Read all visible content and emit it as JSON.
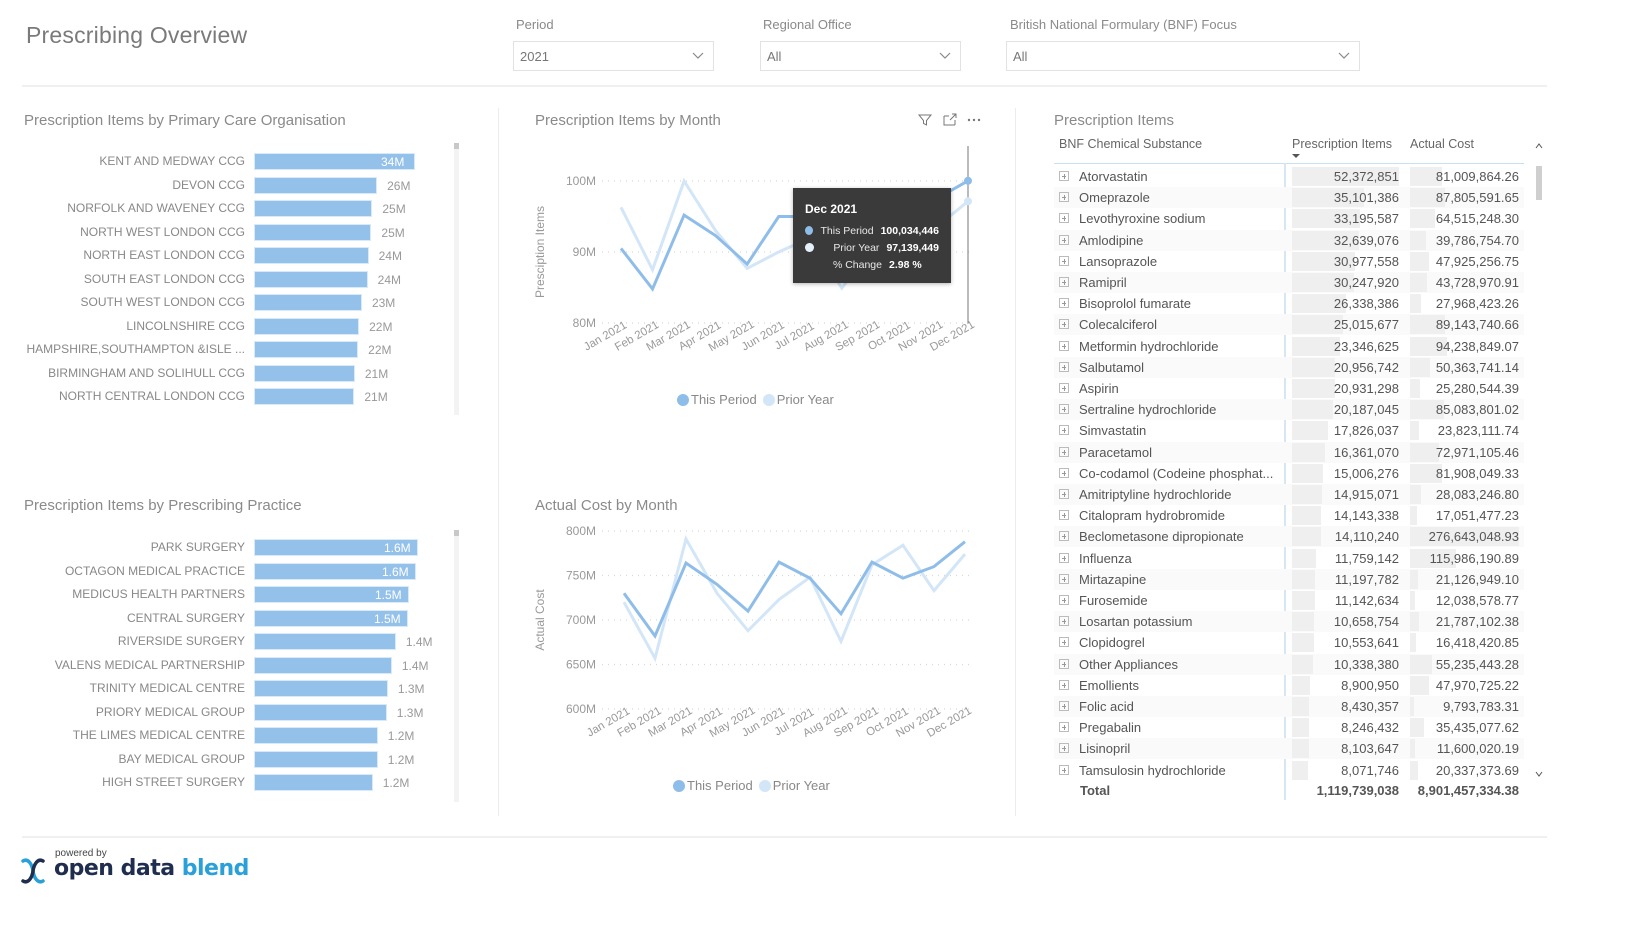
{
  "page": {
    "title": "Prescribing Overview"
  },
  "slicers": [
    {
      "label": "Period",
      "value": "2021"
    },
    {
      "label": "Regional Office",
      "value": "All"
    },
    {
      "label": "British National Formulary (BNF) Focus",
      "value": "All"
    }
  ],
  "colors": {
    "this_period": "#8fbde9",
    "prior_year": "#d3e6f8",
    "bar": "#94c1ea",
    "tooltip_bg": "#3a3a3a"
  },
  "pco_chart": {
    "title": "Prescription Items by Primary Care Organisation",
    "items": [
      {
        "label": "KENT AND MEDWAY CCG",
        "value": 34,
        "display": "34M",
        "inside": true
      },
      {
        "label": "DEVON CCG",
        "value": 26,
        "display": "26M"
      },
      {
        "label": "NORFOLK AND WAVENEY CCG",
        "value": 25,
        "display": "25M"
      },
      {
        "label": "NORTH WEST LONDON CCG",
        "value": 24.8,
        "display": "25M"
      },
      {
        "label": "NORTH EAST LONDON CCG",
        "value": 24.2,
        "display": "24M"
      },
      {
        "label": "SOUTH EAST LONDON CCG",
        "value": 24,
        "display": "24M"
      },
      {
        "label": "SOUTH WEST LONDON CCG",
        "value": 22.8,
        "display": "23M"
      },
      {
        "label": "LINCOLNSHIRE CCG",
        "value": 22.2,
        "display": "22M"
      },
      {
        "label": "HAMPSHIRE,SOUTHAMPTON &ISLE ...",
        "value": 22,
        "display": "22M"
      },
      {
        "label": "BIRMINGHAM AND SOLIHULL CCG",
        "value": 21.3,
        "display": "21M"
      },
      {
        "label": "NORTH CENTRAL LONDON CCG",
        "value": 21.2,
        "display": "21M"
      }
    ]
  },
  "practice_chart": {
    "title": "Prescription Items by Prescribing Practice",
    "items": [
      {
        "label": "PARK SURGERY",
        "value": 1.63,
        "display": "1.6M",
        "inside": true
      },
      {
        "label": "OCTAGON MEDICAL PRACTICE",
        "value": 1.61,
        "display": "1.6M",
        "inside": true
      },
      {
        "label": "MEDICUS HEALTH PARTNERS",
        "value": 1.54,
        "display": "1.5M",
        "inside": true
      },
      {
        "label": "CENTRAL SURGERY",
        "value": 1.53,
        "display": "1.5M",
        "inside": true
      },
      {
        "label": "RIVERSIDE SURGERY",
        "value": 1.41,
        "display": "1.4M"
      },
      {
        "label": "VALENS MEDICAL PARTNERSHIP",
        "value": 1.37,
        "display": "1.4M"
      },
      {
        "label": "TRINITY MEDICAL CENTRE",
        "value": 1.33,
        "display": "1.3M"
      },
      {
        "label": "PRIORY MEDICAL GROUP",
        "value": 1.32,
        "display": "1.3M"
      },
      {
        "label": "THE LIMES MEDICAL CENTRE",
        "value": 1.23,
        "display": "1.2M"
      },
      {
        "label": "BAY MEDICAL GROUP",
        "value": 1.23,
        "display": "1.2M"
      },
      {
        "label": "HIGH STREET SURGERY",
        "value": 1.18,
        "display": "1.2M"
      }
    ]
  },
  "chart_data": [
    {
      "type": "line",
      "title": "Prescription Items by Month",
      "xlabel": "",
      "ylabel": "Presciption Items",
      "categories": [
        "Jan 2021",
        "Feb 2021",
        "Mar 2021",
        "Apr 2021",
        "May 2021",
        "Jun 2021",
        "Jul 2021",
        "Aug 2021",
        "Sep 2021",
        "Oct 2021",
        "Nov 2021",
        "Dec 2021"
      ],
      "ylim": [
        80,
        100
      ],
      "yticks": [
        "80M",
        "90M",
        "100M"
      ],
      "ytick_values": [
        80,
        90,
        100
      ],
      "grid": true,
      "legend": "bottom",
      "series": [
        {
          "name": "This Period",
          "values": [
            90.5,
            84.8,
            95.2,
            92.3,
            88.3,
            95.0,
            95.0,
            96.5,
            97.0,
            96.0,
            97.5,
            100.03
          ]
        },
        {
          "name": "Prior Year",
          "values": [
            96.3,
            87.5,
            100.0,
            93.0,
            87.7,
            90.0,
            92.0,
            84.9,
            91.0,
            93.0,
            93.5,
            97.14
          ]
        }
      ],
      "tooltip": {
        "title": "Dec 2021",
        "rows": [
          {
            "key": "This Period",
            "value": "100,034,446",
            "dot": "this_period"
          },
          {
            "key": "Prior Year",
            "value": "97,139,449",
            "dot": "prior_year"
          },
          {
            "key": "% Change",
            "value": "2.98 %"
          }
        ]
      }
    },
    {
      "type": "line",
      "title": "Actual Cost by Month",
      "xlabel": "",
      "ylabel": "Actual Cost",
      "categories": [
        "Jan 2021",
        "Feb 2021",
        "Mar 2021",
        "Apr 2021",
        "May 2021",
        "Jun 2021",
        "Jul 2021",
        "Aug 2021",
        "Sep 2021",
        "Oct 2021",
        "Nov 2021",
        "Dec 2021"
      ],
      "ylim": [
        600,
        800
      ],
      "yticks": [
        "600M",
        "650M",
        "700M",
        "750M",
        "800M"
      ],
      "ytick_values": [
        600,
        650,
        700,
        750,
        800
      ],
      "grid": true,
      "legend": "bottom",
      "series": [
        {
          "name": "This Period",
          "values": [
            730,
            682,
            764,
            740,
            710,
            765,
            747,
            707,
            765,
            747,
            760,
            788
          ]
        },
        {
          "name": "Prior Year",
          "values": [
            720,
            657,
            791,
            730,
            688,
            723,
            748,
            676,
            762,
            784,
            733,
            774
          ]
        }
      ]
    }
  ],
  "legend": {
    "this_period": "This Period",
    "prior_year": "Prior Year"
  },
  "visual_header_icons": [
    "filter-icon",
    "focus-mode-icon",
    "more-options-icon"
  ],
  "table": {
    "title": "Prescription Items",
    "columns": [
      "BNF Chemical Substance",
      "Prescription Items",
      "Actual Cost"
    ],
    "sort_column": "Prescription Items",
    "rows": [
      {
        "name": "Atorvastatin",
        "items": "52,372,851",
        "items_num": 52372851,
        "cost": "81,009,864.26",
        "cost_num": 81009864
      },
      {
        "name": "Omeprazole",
        "items": "35,101,386",
        "items_num": 35101386,
        "cost": "87,805,591.65",
        "cost_num": 87805591
      },
      {
        "name": "Levothyroxine sodium",
        "items": "33,195,587",
        "items_num": 33195587,
        "cost": "64,515,248.30",
        "cost_num": 64515248
      },
      {
        "name": "Amlodipine",
        "items": "32,639,076",
        "items_num": 32639076,
        "cost": "39,786,754.70",
        "cost_num": 39786754
      },
      {
        "name": "Lansoprazole",
        "items": "30,977,558",
        "items_num": 30977558,
        "cost": "47,925,256.75",
        "cost_num": 47925256
      },
      {
        "name": "Ramipril",
        "items": "30,247,920",
        "items_num": 30247920,
        "cost": "43,728,970.91",
        "cost_num": 43728970
      },
      {
        "name": "Bisoprolol fumarate",
        "items": "26,338,386",
        "items_num": 26338386,
        "cost": "27,968,423.26",
        "cost_num": 27968423
      },
      {
        "name": "Colecalciferol",
        "items": "25,015,677",
        "items_num": 25015677,
        "cost": "89,143,740.66",
        "cost_num": 89143740
      },
      {
        "name": "Metformin hydrochloride",
        "items": "23,346,625",
        "items_num": 23346625,
        "cost": "94,238,849.07",
        "cost_num": 94238849
      },
      {
        "name": "Salbutamol",
        "items": "20,956,742",
        "items_num": 20956742,
        "cost": "50,363,741.14",
        "cost_num": 50363741
      },
      {
        "name": "Aspirin",
        "items": "20,931,298",
        "items_num": 20931298,
        "cost": "25,280,544.39",
        "cost_num": 25280544
      },
      {
        "name": "Sertraline hydrochloride",
        "items": "20,187,045",
        "items_num": 20187045,
        "cost": "85,083,801.02",
        "cost_num": 85083801
      },
      {
        "name": "Simvastatin",
        "items": "17,826,037",
        "items_num": 17826037,
        "cost": "23,823,111.74",
        "cost_num": 23823111
      },
      {
        "name": "Paracetamol",
        "items": "16,361,070",
        "items_num": 16361070,
        "cost": "72,971,105.46",
        "cost_num": 72971105
      },
      {
        "name": "Co-codamol (Codeine phosphat...",
        "items": "15,006,276",
        "items_num": 15006276,
        "cost": "81,908,049.33",
        "cost_num": 81908049
      },
      {
        "name": "Amitriptyline hydrochloride",
        "items": "14,915,071",
        "items_num": 14915071,
        "cost": "28,083,246.80",
        "cost_num": 28083246
      },
      {
        "name": "Citalopram hydrobromide",
        "items": "14,143,338",
        "items_num": 14143338,
        "cost": "17,051,477.23",
        "cost_num": 17051477
      },
      {
        "name": "Beclometasone dipropionate",
        "items": "14,110,240",
        "items_num": 14110240,
        "cost": "276,643,048.93",
        "cost_num": 276643048
      },
      {
        "name": "Influenza",
        "items": "11,759,142",
        "items_num": 11759142,
        "cost": "115,986,190.89",
        "cost_num": 115986190
      },
      {
        "name": "Mirtazapine",
        "items": "11,197,782",
        "items_num": 11197782,
        "cost": "21,126,949.10",
        "cost_num": 21126949
      },
      {
        "name": "Furosemide",
        "items": "11,142,634",
        "items_num": 11142634,
        "cost": "12,038,578.77",
        "cost_num": 12038578
      },
      {
        "name": "Losartan potassium",
        "items": "10,658,754",
        "items_num": 10658754,
        "cost": "21,787,102.38",
        "cost_num": 21787102
      },
      {
        "name": "Clopidogrel",
        "items": "10,553,641",
        "items_num": 10553641,
        "cost": "16,418,420.85",
        "cost_num": 16418420
      },
      {
        "name": "Other Appliances",
        "items": "10,338,380",
        "items_num": 10338380,
        "cost": "55,235,443.28",
        "cost_num": 55235443
      },
      {
        "name": "Emollients",
        "items": "8,900,950",
        "items_num": 8900950,
        "cost": "47,970,725.22",
        "cost_num": 47970725
      },
      {
        "name": "Folic acid",
        "items": "8,430,357",
        "items_num": 8430357,
        "cost": "9,793,783.31",
        "cost_num": 9793783
      },
      {
        "name": "Pregabalin",
        "items": "8,246,432",
        "items_num": 8246432,
        "cost": "35,435,077.62",
        "cost_num": 35435077
      },
      {
        "name": "Lisinopril",
        "items": "8,103,647",
        "items_num": 8103647,
        "cost": "11,600,020.19",
        "cost_num": 11600020
      },
      {
        "name": "Tamsulosin hydrochloride",
        "items": "8,071,746",
        "items_num": 8071746,
        "cost": "20,337,373.69",
        "cost_num": 20337373
      }
    ],
    "total": {
      "label": "Total",
      "items": "1,119,739,038",
      "cost": "8,901,457,334.38"
    }
  },
  "footer": {
    "powered_by": "powered by",
    "brand_part1": "open data",
    "brand_part2": "blend"
  }
}
